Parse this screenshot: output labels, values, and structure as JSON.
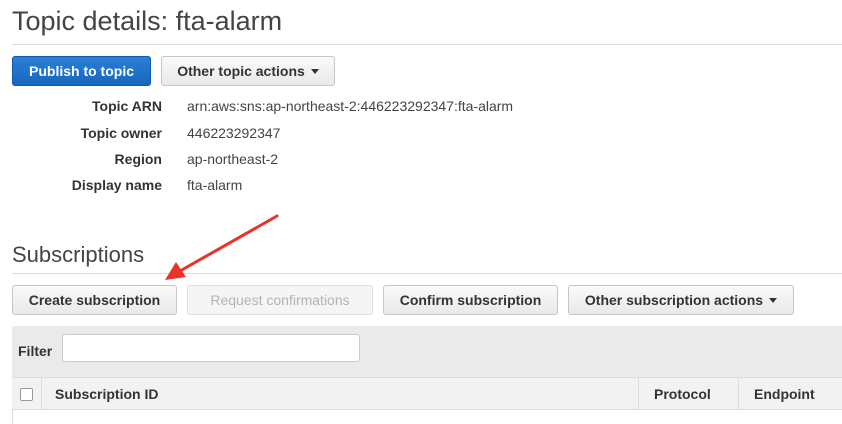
{
  "page": {
    "title": "Topic details: fta-alarm"
  },
  "actions": {
    "publish": "Publish to topic",
    "other_topic_actions": "Other topic actions"
  },
  "details": [
    {
      "label": "Topic ARN",
      "value": "arn:aws:sns:ap-northeast-2:446223292347:fta-alarm"
    },
    {
      "label": "Topic owner",
      "value": "446223292347"
    },
    {
      "label": "Region",
      "value": "ap-northeast-2"
    },
    {
      "label": "Display name",
      "value": "fta-alarm"
    }
  ],
  "subscriptions": {
    "title": "Subscriptions",
    "buttons": {
      "create": "Create subscription",
      "request_confirmations": "Request confirmations",
      "confirm": "Confirm subscription",
      "other_actions": "Other subscription actions"
    },
    "filter_label": "Filter",
    "filter_value": "",
    "columns": [
      "Subscription ID",
      "Protocol",
      "Endpoint"
    ]
  },
  "annotation": {
    "arrow_color": "#e8332a"
  },
  "colors": {
    "primary": "#1766c0"
  }
}
